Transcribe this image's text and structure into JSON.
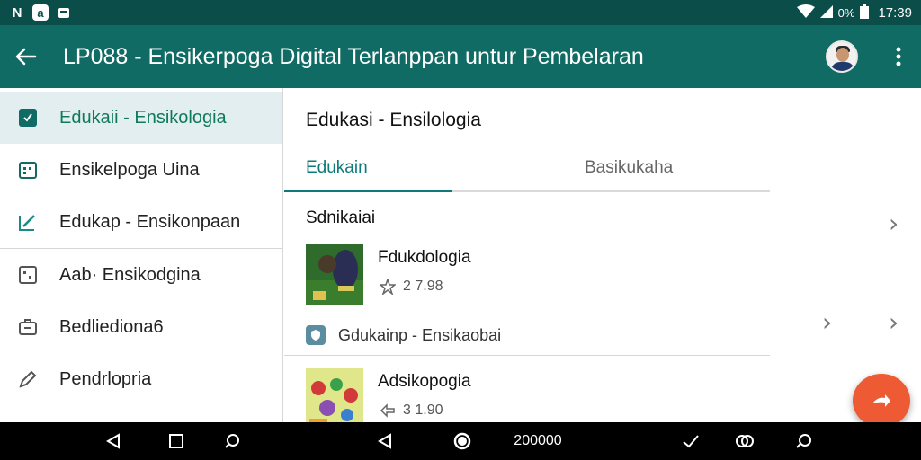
{
  "status_bar": {
    "left_icons": [
      "N",
      "a",
      "battery-small"
    ],
    "battery": "0%",
    "time": "17:39"
  },
  "app_bar": {
    "title": "LP088 - Ensikerpoga Digital Terlanppan untur Pembelaran"
  },
  "sidebar": {
    "items": [
      {
        "label": "Edukaii - Ensikologia",
        "icon": "document-icon"
      },
      {
        "label": "Ensikelpoga Uina",
        "icon": "grid-calendar-icon"
      },
      {
        "label": "Edukap  - Ensikonpaan",
        "icon": "edit-icon"
      },
      {
        "label": "Aab· Ensikodgina",
        "icon": "list-icon"
      },
      {
        "label": "Bedliediona6",
        "icon": "briefcase-icon"
      },
      {
        "label": "Pendrlopria",
        "icon": "pencil-icon"
      }
    ]
  },
  "content": {
    "section_title": "Edukasi - Ensilologia",
    "tabs": [
      {
        "label": "Edukain"
      },
      {
        "label": "Basikukaha"
      }
    ],
    "subhead": "Sdnikaiai",
    "cards": [
      {
        "title": "Fdukdologia",
        "meta": "2 7.98"
      },
      {
        "title": "Adsikopogia",
        "meta": "3 1.90"
      }
    ],
    "link_row": {
      "label": "Gdukainp - Ensikaobai"
    }
  },
  "nav_bar": {
    "zoom_label": "200000"
  },
  "colors": {
    "status_bar": "#0b4d48",
    "app_bar": "#0f6b63",
    "accent": "#0f7a7a",
    "active_item_bg": "#e3eef1",
    "fab": "#ee5a33"
  }
}
